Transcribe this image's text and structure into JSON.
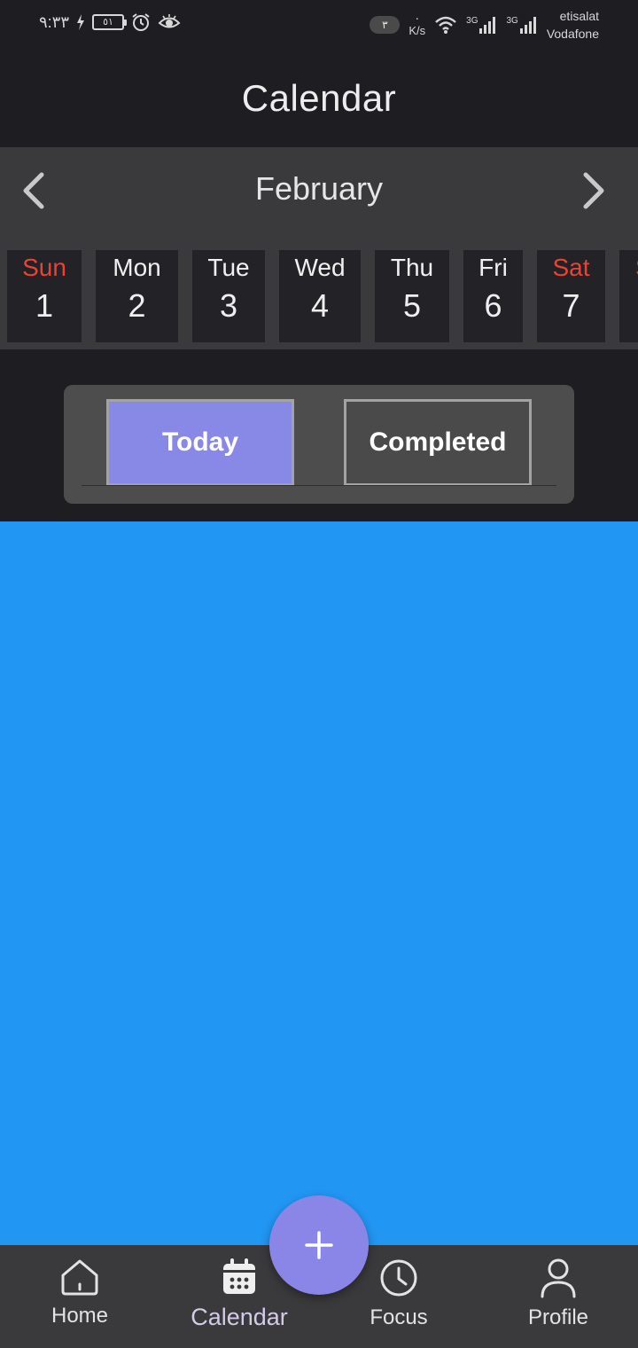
{
  "status_bar": {
    "time": "٩:٣٣",
    "battery": "٥١",
    "notification_count": "٣",
    "speed_value": "٠",
    "speed_unit": "K/s",
    "network_type_1": "3G",
    "network_type_2": "3G",
    "carrier_1": "etisalat",
    "carrier_2": "Vodafone"
  },
  "app_bar": {
    "title": "Calendar"
  },
  "month": {
    "label": "February",
    "prev_icon": "chevron-left-icon",
    "next_icon": "chevron-right-icon"
  },
  "days": [
    {
      "name": "Sun",
      "num": "1",
      "weekend": true
    },
    {
      "name": "Mon",
      "num": "2",
      "weekend": false
    },
    {
      "name": "Tue",
      "num": "3",
      "weekend": false
    },
    {
      "name": "Wed",
      "num": "4",
      "weekend": false
    },
    {
      "name": "Thu",
      "num": "5",
      "weekend": false
    },
    {
      "name": "Fri",
      "num": "6",
      "weekend": false
    },
    {
      "name": "Sat",
      "num": "7",
      "weekend": true
    },
    {
      "name": "S",
      "num": "",
      "weekend": true
    }
  ],
  "tabs": {
    "today": "Today",
    "completed": "Completed",
    "selected": "today"
  },
  "colors": {
    "accent": "#8888e6",
    "weekend": "#e94335",
    "content_background": "#2196f3",
    "fab": "#8a86e8"
  },
  "fab": {
    "icon": "plus-icon"
  },
  "bottom_nav": {
    "items": [
      {
        "label": "Home",
        "icon": "home-icon"
      },
      {
        "label": "Calendar",
        "icon": "calendar-icon",
        "active": true
      },
      {
        "label": "Focus",
        "icon": "clock-icon"
      },
      {
        "label": "Profile",
        "icon": "user-icon"
      }
    ]
  }
}
